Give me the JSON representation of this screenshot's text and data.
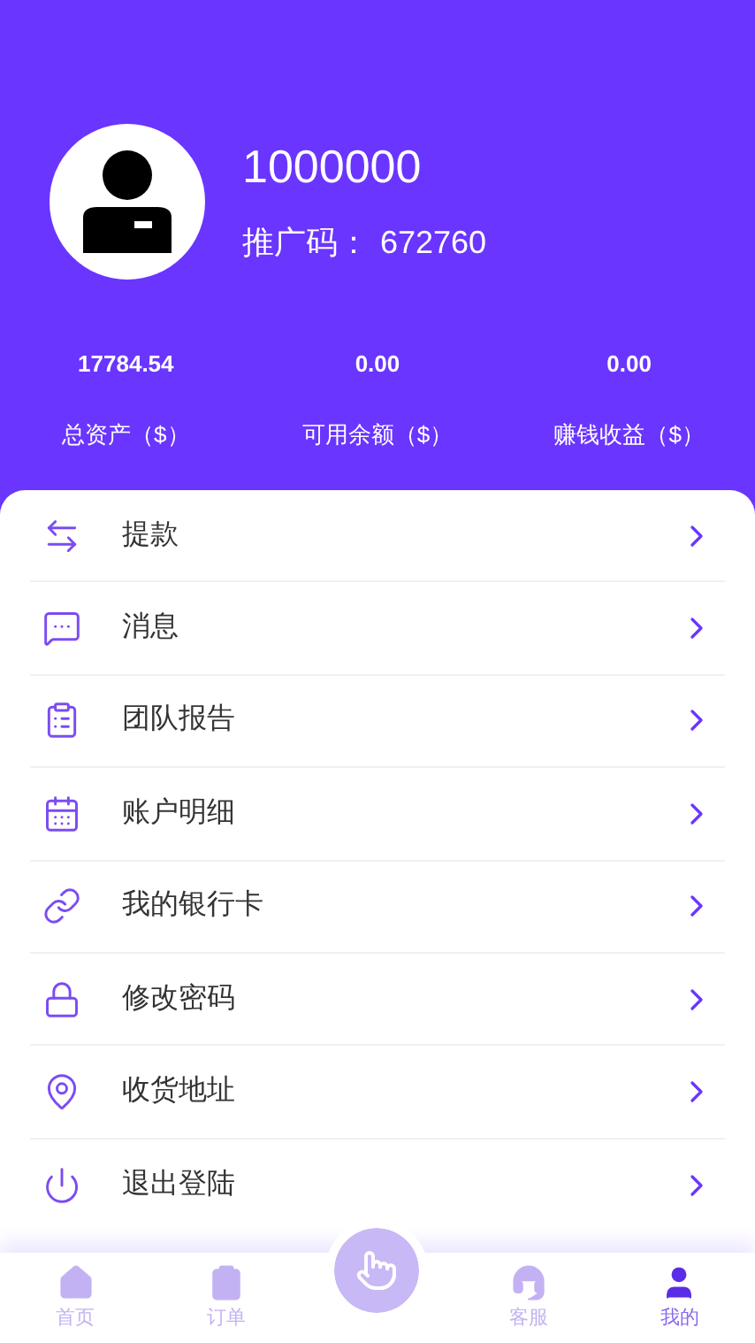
{
  "profile": {
    "username": "1000000",
    "promo_label": "推广码：",
    "promo_code": "672760"
  },
  "stats": [
    {
      "value": "17784.54",
      "label": "总资产（$）"
    },
    {
      "value": "0.00",
      "label": "可用余额（$）"
    },
    {
      "value": "0.00",
      "label": "赚钱收益（$）"
    }
  ],
  "menu": [
    {
      "kind": "withdraw",
      "label": "提款"
    },
    {
      "kind": "message",
      "label": "消息"
    },
    {
      "kind": "report",
      "label": "团队报告"
    },
    {
      "kind": "ledger",
      "label": "账户明细"
    },
    {
      "kind": "card",
      "label": "我的银行卡"
    },
    {
      "kind": "password",
      "label": "修改密码"
    },
    {
      "kind": "address",
      "label": "收货地址"
    },
    {
      "kind": "logout",
      "label": "退出登陆"
    }
  ],
  "tabs": [
    {
      "kind": "home",
      "label": "首页",
      "selected": false
    },
    {
      "kind": "orders",
      "label": "订单",
      "selected": false
    },
    {
      "kind": "center",
      "selected": false
    },
    {
      "kind": "service",
      "label": "客服",
      "selected": false
    },
    {
      "kind": "me",
      "label": "我的",
      "selected": true
    }
  ]
}
